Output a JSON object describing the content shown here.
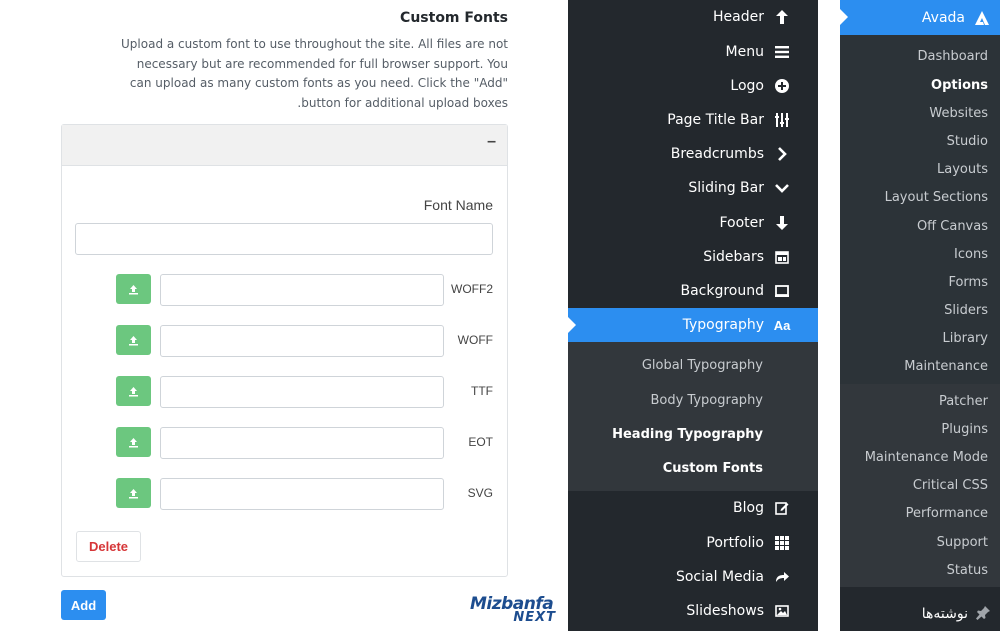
{
  "custom_fonts": {
    "title": "Custom Fonts",
    "description": "Upload a custom font to use throughout the site. All files are not necessary but are recommended for full browser support. You can upload as many custom fonts as you need. Click the \"Add\" button for additional upload boxes.",
    "collapse_symbol": "–",
    "font_name_label": "Font Name",
    "font_name_value": "",
    "upload_rows": [
      {
        "format": "WOFF2",
        "value": ""
      },
      {
        "format": "WOFF",
        "value": ""
      },
      {
        "format": "TTF",
        "value": ""
      },
      {
        "format": "EOT",
        "value": ""
      },
      {
        "format": "SVG",
        "value": ""
      }
    ],
    "delete_label": "Delete",
    "add_label": "Add"
  },
  "logo": {
    "top": "Mizbanfa",
    "bottom": "NEXT"
  },
  "options_menu": {
    "items": [
      {
        "label": "Header",
        "icon": "arrow-up-icon"
      },
      {
        "label": "Menu",
        "icon": "menu-icon"
      },
      {
        "label": "Logo",
        "icon": "plus-circle-icon"
      },
      {
        "label": "Page Title Bar",
        "icon": "sliders-icon"
      },
      {
        "label": "Breadcrumbs",
        "icon": "chevron-right-icon"
      },
      {
        "label": "Sliding Bar",
        "icon": "chevron-down-icon"
      },
      {
        "label": "Footer",
        "icon": "arrow-down-icon"
      },
      {
        "label": "Sidebars",
        "icon": "sidebars-icon"
      },
      {
        "label": "Background",
        "icon": "monitor-icon"
      },
      {
        "label": "Typography",
        "icon": "typography-icon",
        "active": true
      }
    ],
    "typography_sub": [
      {
        "label": "Global Typography"
      },
      {
        "label": "Body Typography"
      },
      {
        "label": "Heading Typography"
      },
      {
        "label": "Custom Fonts",
        "current": true
      }
    ],
    "items_after": [
      {
        "label": "Blog",
        "icon": "edit-icon"
      },
      {
        "label": "Portfolio",
        "icon": "grid-icon"
      },
      {
        "label": "Social Media",
        "icon": "share-icon"
      },
      {
        "label": "Slideshows",
        "icon": "image-icon"
      }
    ]
  },
  "wp_menu": {
    "avada_label": "Avada",
    "avada_sub": [
      {
        "label": "Dashboard"
      },
      {
        "label": "Options",
        "current": true
      },
      {
        "label": "Websites"
      },
      {
        "label": "Studio"
      },
      {
        "label": "Layouts"
      },
      {
        "label": "Layout Sections"
      },
      {
        "label": "Off Canvas"
      },
      {
        "label": "Icons"
      },
      {
        "label": "Forms"
      },
      {
        "label": "Sliders"
      },
      {
        "label": "Library"
      },
      {
        "label": "Maintenance"
      }
    ],
    "avada_sub2": [
      {
        "label": "Patcher"
      },
      {
        "label": "Plugins"
      },
      {
        "label": "Maintenance Mode"
      },
      {
        "label": "Critical CSS"
      },
      {
        "label": "Performance"
      },
      {
        "label": "Support"
      },
      {
        "label": "Status"
      }
    ],
    "posts_label": "نوشته‌ها"
  },
  "colors": {
    "accent": "#2c8ef0",
    "menu_bg": "#23282d",
    "upload_green": "#6cc77f",
    "delete_red": "#d63638"
  }
}
